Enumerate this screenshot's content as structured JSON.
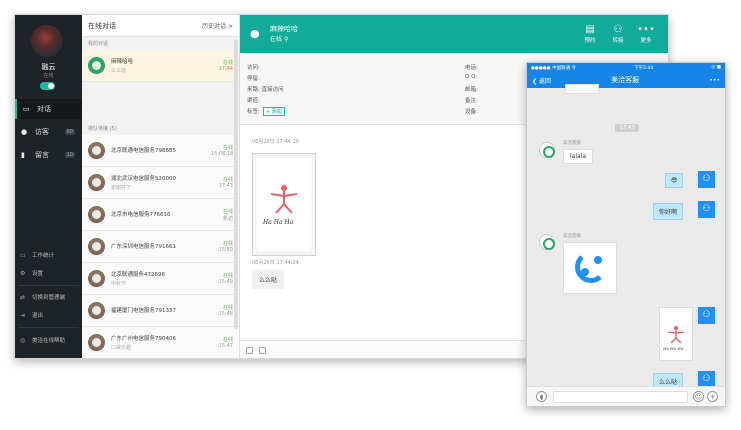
{
  "sidebar": {
    "user_name": "融云",
    "user_status": "在线",
    "nav": [
      {
        "label": "对话",
        "icon": "chat-icon",
        "count": ""
      },
      {
        "label": "访客",
        "icon": "visitor-icon",
        "count": "60"
      },
      {
        "label": "留言",
        "icon": "message-icon",
        "count": "10"
      }
    ],
    "bottom": [
      {
        "label": "工作统计",
        "icon": "stats-icon"
      },
      {
        "label": "设置",
        "icon": "settings-icon"
      },
      {
        "label": "切换到管理端",
        "icon": "switch-icon"
      },
      {
        "label": "退出",
        "icon": "exit-icon"
      },
      {
        "label": "美洽在线帮助",
        "icon": "help-icon"
      }
    ]
  },
  "conv_list": {
    "title": "在线对话",
    "history_link": "历史对话 >",
    "section_mine": "我的对话",
    "section_queue": "排队待接 (5)",
    "mine": [
      {
        "name": "麻辣哈哈",
        "msg": "么么哒",
        "status": "在线",
        "time": "17:44"
      }
    ],
    "queue": [
      {
        "name": "北京联通电信服务798885",
        "msg": "",
        "status": "在线",
        "time": "15:06:18"
      },
      {
        "name": "湖北武汉电信服务520000",
        "msg": "谢谢好了",
        "status": "在线",
        "time": "17:43"
      },
      {
        "name": "北京市电信服务776616",
        "msg": "",
        "status": "在线",
        "time": "新访"
      },
      {
        "name": "广东深圳电信服务791661",
        "msg": "",
        "status": "在线",
        "time": "15:50"
      },
      {
        "name": "北京联通服务472696",
        "msg": "中秋节",
        "status": "在线",
        "time": "15:49"
      },
      {
        "name": "福建厦门电信服务791337",
        "msg": "",
        "status": "在线",
        "time": "15:48"
      },
      {
        "name": "广东广州电信服务790406",
        "msg": "口袋乐趣",
        "status": "在线",
        "time": "15:47"
      }
    ]
  },
  "chat": {
    "header_name": "麻辣哈哈",
    "header_status": "在线",
    "buttons": [
      {
        "label": "预约",
        "icon": "calendar-icon"
      },
      {
        "label": "转接",
        "icon": "transfer-icon"
      },
      {
        "label": "更多",
        "icon": "more-icon"
      }
    ],
    "info_left": [
      {
        "label": "访问:",
        "value": ""
      },
      {
        "label": "停留:",
        "value": ""
      },
      {
        "label": "来路:",
        "value": "直接访问"
      },
      {
        "label": "渠道:",
        "value": ""
      },
      {
        "label": "标签:",
        "value": "+ 添加"
      }
    ],
    "info_right": [
      {
        "label": "电话:",
        "value": ""
      },
      {
        "label": "Q Q:",
        "value": ""
      },
      {
        "label": "邮箱:",
        "value": ""
      },
      {
        "label": "备注:",
        "value": ""
      },
      {
        "label": "设备:",
        "value": ""
      }
    ],
    "msg1_time": "06月26日 17:44:19",
    "msg2_time": "06月26日 17:44:24",
    "msg2_text": "么么哒",
    "image_caption": "Ha Ha Ha"
  },
  "phone": {
    "carrier": "●●●●● 中国联通 令",
    "clock": "下午5:44",
    "battery": "◎ ■",
    "back_label": "返回",
    "title": "美洽客服",
    "more": "•••",
    "time_badge": "17:43",
    "agent_tag": "美洽客服",
    "agent_msg": "lalala",
    "user_emoji": "😎",
    "user_msg": "你好啊",
    "user_msg2": "么么哒",
    "image_caption": "Ha Ha Ha"
  }
}
